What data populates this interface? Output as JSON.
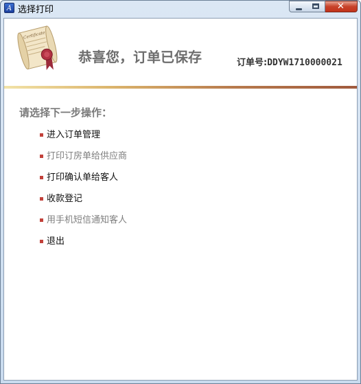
{
  "window": {
    "title": "选择打印",
    "app_icon": "app-logo-icon",
    "controls": [
      "minimize-icon",
      "maximize-icon",
      "close-icon"
    ]
  },
  "header": {
    "badge_icon": "certificate-icon",
    "badge_text": "Certificate",
    "congrats": "恭喜您，订单已保存",
    "order_label": "订单号:",
    "order_number": "DDYW1710000021"
  },
  "prompt": "请选择下一步操作：",
  "actions": [
    {
      "label": "进入订单管理",
      "style": "dark"
    },
    {
      "label": "打印订房单给供应商",
      "style": "gray"
    },
    {
      "label": "打印确认单给客人",
      "style": "dark"
    },
    {
      "label": "收款登记",
      "style": "dark"
    },
    {
      "label": "用手机短信通知客人",
      "style": "gray"
    },
    {
      "label": "退出",
      "style": "dark"
    }
  ],
  "colors": {
    "bullet": "#c2413a",
    "divider_start": "#f2e3a8",
    "divider_end": "#a05a3d",
    "congrats_text": "#6e6e6e"
  }
}
